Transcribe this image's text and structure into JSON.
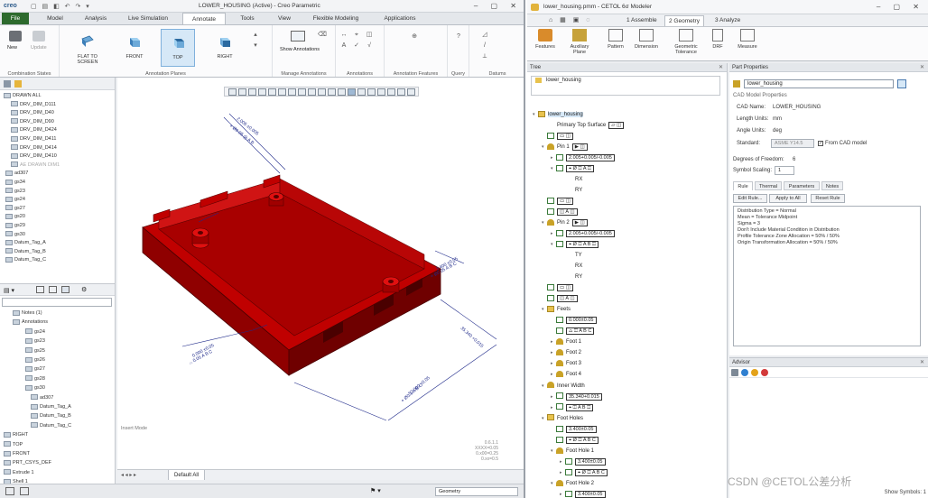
{
  "creo": {
    "logo": "creo",
    "window_title": "LOWER_HOUSING (Active) - Creo Parametric",
    "tabs": [
      "File",
      "Model",
      "Analysis",
      "Live Simulation",
      "Annotate",
      "Tools",
      "View",
      "Flexible Modeling",
      "Applications"
    ],
    "active_tab": "Annotate",
    "ribbon": {
      "groups": [
        "Combination States",
        "Annotation Planes",
        "Manage Annotations",
        "Annotations",
        "Annotation Features",
        "Query",
        "Datums"
      ],
      "combo_buttons": [
        "New",
        "Update"
      ],
      "plane_buttons": [
        "FLAT TO SCREEN",
        "FRONT",
        "TOP",
        "RIGHT"
      ],
      "manage_buttons": [
        "Show Annotations"
      ]
    },
    "model_tree": {
      "items": [
        "DRAWN ALL",
        "DRV_DIM_D111",
        "DRV_DIM_D40",
        "DRV_DIM_D90",
        "DRV_DIM_D424",
        "DRV_DIM_D411",
        "DRV_DIM_D414",
        "DRV_DIM_D410",
        "AE DRAWN DIM1",
        "ad307",
        "gs34",
        "gs23",
        "gs24",
        "gs27",
        "gs20",
        "gs29",
        "gs30",
        "Datum_Tag_A",
        "Datum_Tag_B",
        "Datum_Tag_C"
      ]
    },
    "layer_tree": {
      "items": [
        "Notes (1)",
        "Annotations",
        "gs24",
        "gs23",
        "gs25",
        "gs26",
        "gs27",
        "gs28",
        "gs30",
        "ad307",
        "Datum_Tag_A",
        "Datum_Tag_B",
        "Datum_Tag_C",
        "RIGHT",
        "TOP",
        "FRONT",
        "PRT_CSYS_DEF",
        "Extrude 1",
        "Shell 1"
      ]
    },
    "graphics": {
      "insert_mode": "Insert Mode",
      "corner_note": [
        "0.6.1.1",
        "XXXX=0.05",
        "0.x00=0.25",
        "0.xx=0.5"
      ]
    },
    "bottom_tab": "Default All",
    "filter_value": "Geometry"
  },
  "cetol": {
    "window_title": "lower_housing.pmm - CETOL 6σ Modeler",
    "tabs": [
      "1 Assemble",
      "2 Geometry",
      "3 Analyze"
    ],
    "active_tab": "2 Geometry",
    "ribbon": [
      "Features",
      "Auxiliary Plane",
      "Pattern",
      "Dimension",
      "Geometric Tolerance",
      "DRF",
      "Measure"
    ],
    "tree_header": "Tree",
    "top_node": "lower_housing",
    "tree": [
      {
        "indent": 0,
        "tw": "▾",
        "icon": "folder",
        "label": "lower_housing"
      },
      {
        "indent": 1,
        "tw": "",
        "icon": "arrow",
        "label": "Primary Top Surface",
        "fcf": "▱ ◫"
      },
      {
        "indent": 1,
        "tw": "",
        "icon": "feat",
        "label": "",
        "fcf": "▭ ◫"
      },
      {
        "indent": 1,
        "tw": "▾",
        "icon": "pin",
        "label": "Pin 1",
        "fcf": "▶ ◫"
      },
      {
        "indent": 2,
        "tw": "▸",
        "icon": "feat",
        "label": "",
        "fcf": "2.005+0.005/-0.005"
      },
      {
        "indent": 2,
        "tw": "▾",
        "icon": "feat",
        "label": "",
        "fcf": "⌖ Ø ◫ A ◫"
      },
      {
        "indent": 3,
        "tw": "",
        "icon": "arrow",
        "label": "RX",
        "fcf": ""
      },
      {
        "indent": 3,
        "tw": "",
        "icon": "arrow",
        "label": "RY",
        "fcf": ""
      },
      {
        "indent": 1,
        "tw": "",
        "icon": "feat",
        "label": "",
        "fcf": "▭ ◫"
      },
      {
        "indent": 1,
        "tw": "",
        "icon": "feat",
        "label": "",
        "fcf": "◫ A ◫"
      },
      {
        "indent": 1,
        "tw": "▾",
        "icon": "pin",
        "label": "Pin 2",
        "fcf": "▶ ◫"
      },
      {
        "indent": 2,
        "tw": "▸",
        "icon": "feat",
        "label": "",
        "fcf": "2.005+0.005/-0.005"
      },
      {
        "indent": 2,
        "tw": "▾",
        "icon": "feat",
        "label": "",
        "fcf": "⌖ Ø ◫ A B ◫"
      },
      {
        "indent": 3,
        "tw": "",
        "icon": "arrow",
        "label": "TY",
        "fcf": ""
      },
      {
        "indent": 3,
        "tw": "",
        "icon": "arrow",
        "label": "RX",
        "fcf": ""
      },
      {
        "indent": 3,
        "tw": "",
        "icon": "arrow",
        "label": "RY",
        "fcf": ""
      },
      {
        "indent": 1,
        "tw": "",
        "icon": "feat",
        "label": "",
        "fcf": "▭ ◫"
      },
      {
        "indent": 1,
        "tw": "",
        "icon": "feat",
        "label": "",
        "fcf": "◫ A ◫"
      },
      {
        "indent": 1,
        "tw": "▾",
        "icon": "folder",
        "label": "Feets",
        "fcf": ""
      },
      {
        "indent": 2,
        "tw": "",
        "icon": "feat",
        "label": "",
        "fcf": "0.000±0.05"
      },
      {
        "indent": 2,
        "tw": "",
        "icon": "feat",
        "label": "",
        "fcf": "⌓ ◫ A B C"
      },
      {
        "indent": 2,
        "tw": "▸",
        "icon": "pin",
        "label": "Foot 1",
        "fcf": ""
      },
      {
        "indent": 2,
        "tw": "▸",
        "icon": "pin",
        "label": "Foot 2",
        "fcf": ""
      },
      {
        "indent": 2,
        "tw": "▸",
        "icon": "pin",
        "label": "Foot 3",
        "fcf": ""
      },
      {
        "indent": 2,
        "tw": "▸",
        "icon": "pin",
        "label": "Foot 4",
        "fcf": ""
      },
      {
        "indent": 1,
        "tw": "▾",
        "icon": "pin",
        "label": "Inner Width",
        "fcf": ""
      },
      {
        "indent": 2,
        "tw": "▸",
        "icon": "feat",
        "label": "",
        "fcf": "35.340+0.015"
      },
      {
        "indent": 2,
        "tw": "▸",
        "icon": "feat",
        "label": "",
        "fcf": "⌖ ◫ A B ◫"
      },
      {
        "indent": 1,
        "tw": "▾",
        "icon": "folder",
        "label": "Foot Holes",
        "fcf": ""
      },
      {
        "indent": 2,
        "tw": "",
        "icon": "feat",
        "label": "",
        "fcf": "3.400±0.05"
      },
      {
        "indent": 2,
        "tw": "",
        "icon": "feat",
        "label": "",
        "fcf": "⌖ Ø ◫ A B C"
      },
      {
        "indent": 2,
        "tw": "▾",
        "icon": "pin",
        "label": "Foot Hole 1",
        "fcf": ""
      },
      {
        "indent": 3,
        "tw": "▸",
        "icon": "feat",
        "label": "",
        "fcf": "3.400±0.05"
      },
      {
        "indent": 3,
        "tw": "▸",
        "icon": "feat",
        "label": "",
        "fcf": "⌖ Ø ◫ A B C"
      },
      {
        "indent": 2,
        "tw": "▾",
        "icon": "pin",
        "label": "Foot Hole 2",
        "fcf": ""
      },
      {
        "indent": 3,
        "tw": "▸",
        "icon": "feat",
        "label": "",
        "fcf": "3.400±0.05"
      }
    ],
    "part_properties": {
      "header": "Part Properties",
      "name_value": "lower_housing",
      "cad_section": "CAD Model Properties",
      "cad_name_label": "CAD Name:",
      "cad_name_value": "LOWER_HOUSING",
      "length_units_label": "Length Units:",
      "length_units_value": "mm",
      "angle_units_label": "Angle Units:",
      "angle_units_value": "deg",
      "standard_label": "Standard:",
      "standard_value": "ASME Y14.5",
      "from_cad_label": "From CAD model",
      "dof_label": "Degrees of Freedom:",
      "dof_value": "6",
      "symbol_scaling_label": "Symbol Scaling:",
      "symbol_scaling_value": "1",
      "tabs": [
        "Rule",
        "Thermal",
        "Parameters",
        "Notes"
      ],
      "active_tab": "Rule",
      "rule_buttons": [
        "Edit Rule...",
        "Apply to All",
        "Reset Rule"
      ],
      "rule_lines": [
        "Distribution Type = Normal",
        "Mean = Tolerance Midpoint",
        "Sigma = 3",
        "Don't Include Material Condition in Distribution",
        "Profile Tolerance Zone Allocation = 50% / 50%",
        "Origin Transformation Allocation = 50% / 50%"
      ]
    },
    "advisor_header": "Advisor",
    "status": "Show Symbols: 1"
  },
  "watermark": "CSDN @CETOL公差分析",
  "colors": {
    "part_red": "#c00000",
    "part_dark": "#6f0000",
    "annot_blue": "#1f2a8a",
    "file_tab": "#2d6a2d"
  }
}
